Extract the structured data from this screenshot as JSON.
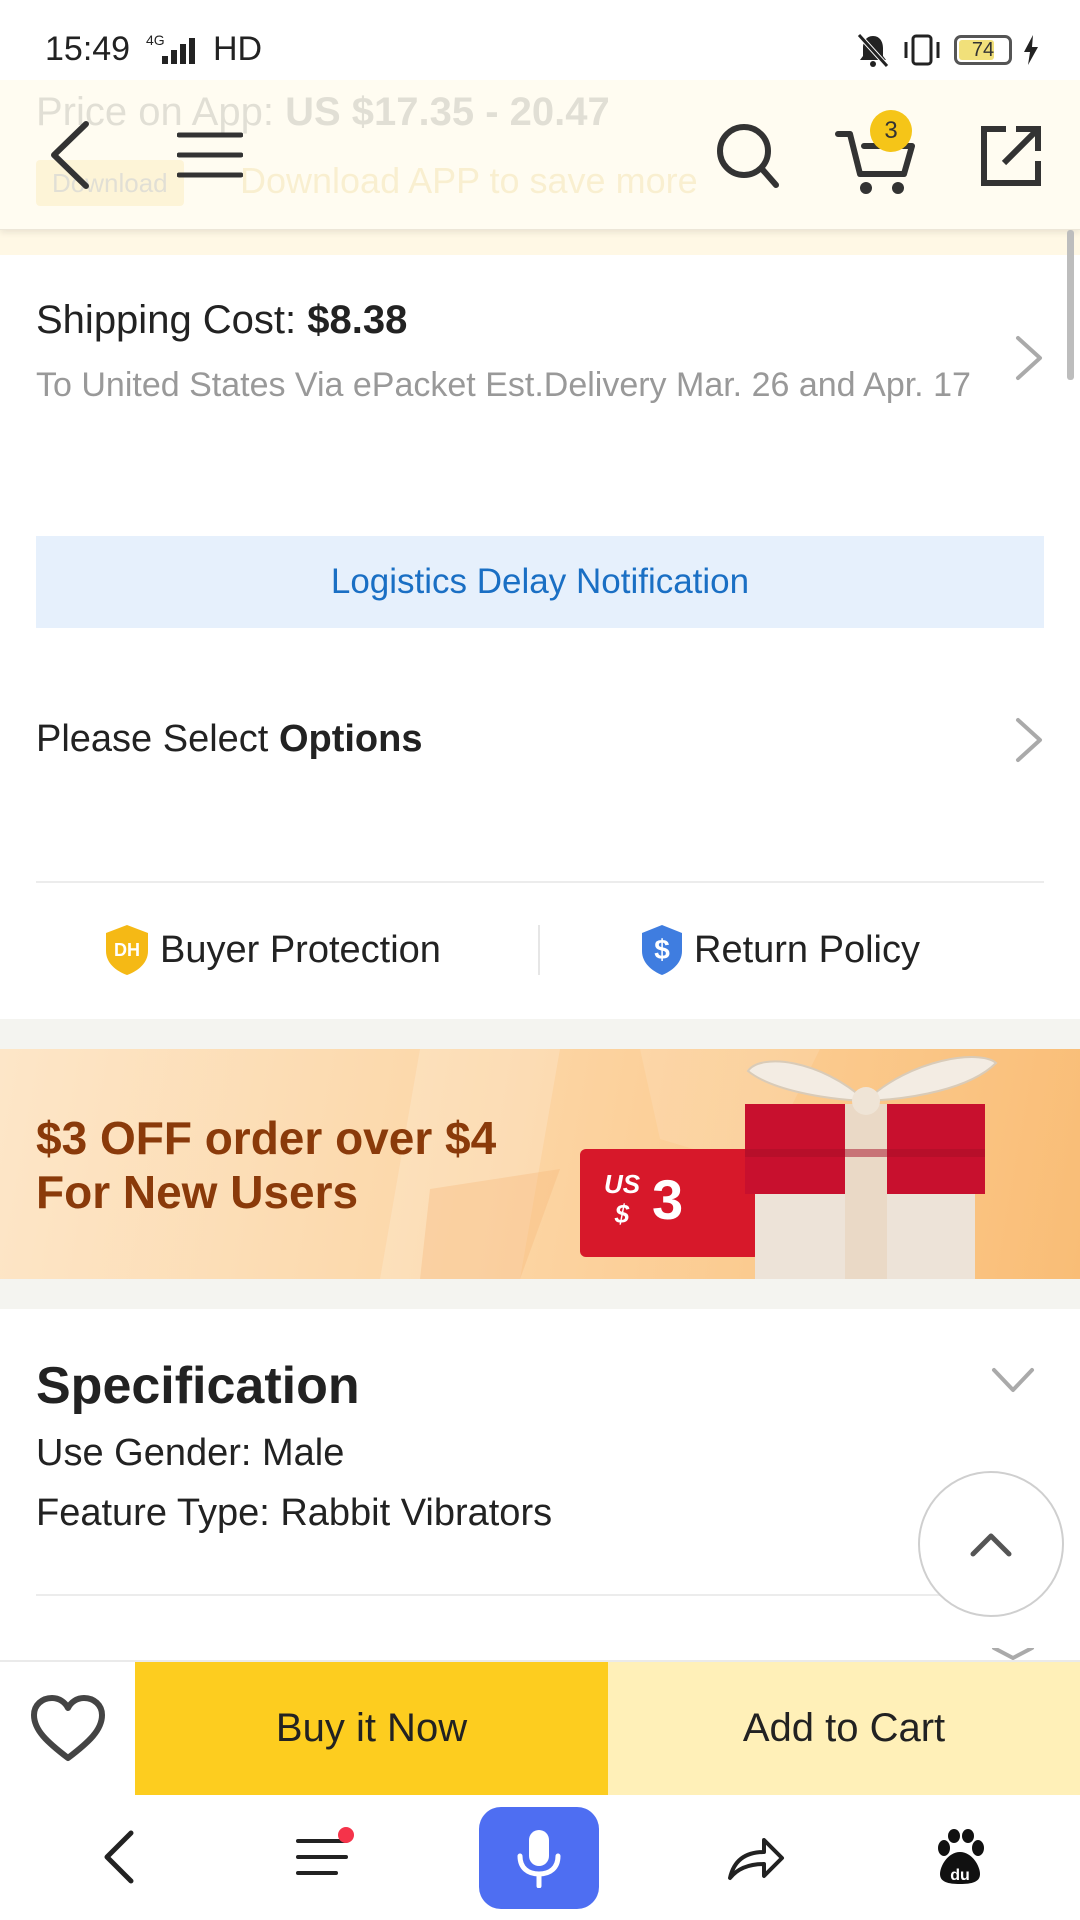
{
  "status_bar": {
    "time": "15:49",
    "network": "4G",
    "hd": "HD",
    "battery": "74"
  },
  "faded_promo": {
    "price_label": "Price on App:",
    "price_value": "US $17.35 - 20.47",
    "download_button": "Download",
    "download_text": "Download APP to save more"
  },
  "header": {
    "cart_count": "3"
  },
  "shipping": {
    "cost_label": "Shipping Cost:",
    "cost_value": "$8.38",
    "description": "To United States Via ePacket Est.Delivery Mar. 26 and Apr. 17"
  },
  "logistics_notice": "Logistics Delay Notification",
  "options": {
    "prefix": "Please Select",
    "emphasis": "Options"
  },
  "protection": {
    "buyer_icon_text": "DH",
    "buyer_label": "Buyer Protection",
    "return_label": "Return Policy"
  },
  "banner": {
    "line1": "$3 OFF order over $4",
    "line2": "For New Users",
    "coupon_currency": "US $",
    "coupon_amount": "3"
  },
  "specification": {
    "title": "Specification",
    "lines": [
      "Use Gender: Male",
      "Feature Type: Rabbit Vibrators"
    ]
  },
  "actions": {
    "buy_now": "Buy it Now",
    "add_to_cart": "Add to Cart"
  },
  "colors": {
    "accent_yellow": "#fdcd1f",
    "cart_button_bg": "#fff0b8",
    "link_blue": "#1a6fc4",
    "mic_blue": "#4e6ef2",
    "banner_text": "#8a3a0a",
    "coupon_red": "#d7182a"
  }
}
